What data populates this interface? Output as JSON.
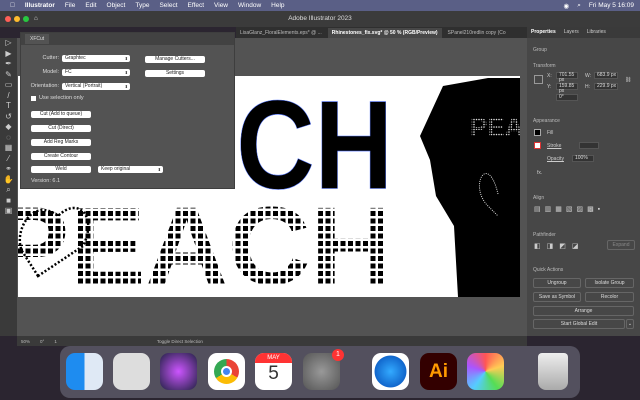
{
  "menubar": {
    "app": "Illustrator",
    "items": [
      "File",
      "Edit",
      "Object",
      "Type",
      "Select",
      "Effect",
      "View",
      "Window",
      "Help"
    ],
    "clock": "Fri May 5  16:09"
  },
  "window": {
    "title": "Adobe Illustrator 2023"
  },
  "doc_tabs": [
    {
      "label": "LisaGlanz_FloralElements.eps* @ ..."
    },
    {
      "label": "Rhinestones_fix.svg* @ 50 % (RGB/Preview)",
      "active": true
    },
    {
      "label": "SPanel210redlin copy (Co"
    }
  ],
  "xfcut": {
    "tab": "XFCut",
    "cutter_label": "Cutter:",
    "cutter": "Graphtec",
    "model_label": "Model:",
    "model": "FC",
    "orientation_label": "Orientation:",
    "orientation": "Vertical (Portrait)",
    "use_selection": "Use selection only",
    "use_selection_checked": false,
    "manage": "Manage Cutters...",
    "settings": "Settings",
    "cut_queue": "Cut (Add to queue)",
    "cut_direct": "Cut (Direct)",
    "reg_marks": "Add Reg Marks",
    "contour": "Create Contour",
    "weld": "Weld",
    "weld_option": "Keep original",
    "version": "Version: 6.1"
  },
  "artwork": {
    "big_text": "PEACH",
    "dot_text": "PEACH",
    "shirt_text": "PEACH"
  },
  "properties": {
    "tabs": [
      "Properties",
      "Layers",
      "Libraries"
    ],
    "selection": "Group",
    "transform": "Transform",
    "x_label": "X:",
    "x": "701.55 px",
    "y_label": "Y:",
    "y": "159.85 px",
    "w_label": "W:",
    "w": "683.9 px",
    "h_label": "H:",
    "h": "229.9 px",
    "angle": "0°",
    "appearance": "Appearance",
    "fill": "Fill",
    "stroke": "Stroke",
    "opacity_label": "Opacity",
    "opacity": "100%",
    "fx": "fx.",
    "align": "Align",
    "pathfinder": "Pathfinder",
    "expand": "Expand",
    "quick_actions": "Quick Actions",
    "ungroup": "Ungroup",
    "isolate": "Isolate Group",
    "save_symbol": "Save as Symbol",
    "recolor": "Recolor",
    "arrange": "Arrange",
    "global_edit": "Start Global Edit"
  },
  "status": {
    "zoom": "50%",
    "rotation": "0°",
    "artboard": "1",
    "tool": "Toggle Direct Selection"
  },
  "dock": {
    "apps": [
      "Finder",
      "Launchpad",
      "Siri",
      "Chrome",
      "Calendar",
      "System Preferences",
      "Safari",
      "Illustrator",
      "Pixelmator",
      "Trash"
    ],
    "calendar_month": "MAY",
    "calendar_day": "5",
    "badge": "1",
    "ai_label": "Ai"
  }
}
